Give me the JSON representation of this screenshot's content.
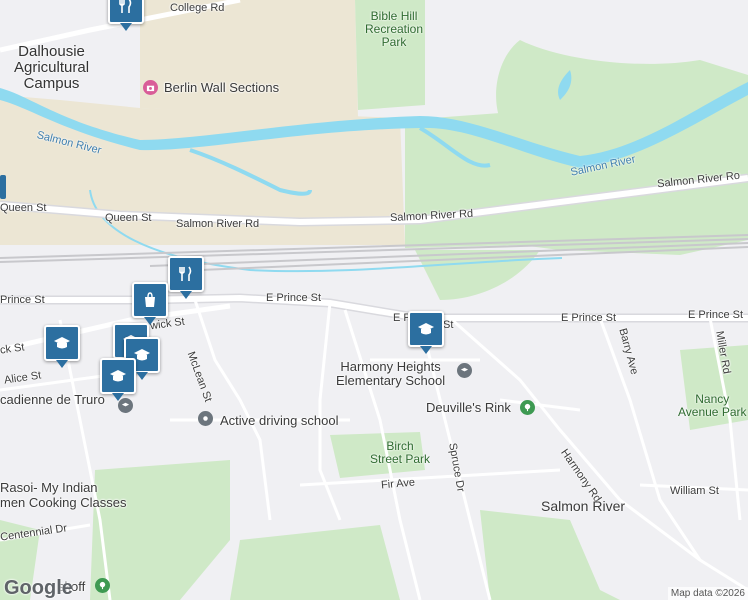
{
  "colors": {
    "water": "#8fdaf0",
    "park": "#cfe9c7",
    "campus": "#ece6d4",
    "road": "#ffffff",
    "pin": "#2c6fa0"
  },
  "labels": {
    "college_rd": "College Rd",
    "dalhousie": "Dalhousie\nAgricultural\nCampus",
    "berlin_wall": "Berlin Wall Sections",
    "bible_hill": "Bible Hill\nRecreation\nPark",
    "salmon_river_west": "Salmon River",
    "salmon_river_east": "Salmon River",
    "salmon_river_rd_east": "Salmon River Ro",
    "queen_st_left": "Queen St",
    "queen_st": "Queen St",
    "salmon_river_rd_1": "Salmon River Rd",
    "salmon_river_rd_2": "Salmon River Rd",
    "prince_st_left": "Prince St",
    "e_prince_st_1": "E Prince St",
    "e_prince_st_2": "E P",
    "e_prince_st_2b": "St",
    "e_prince_st_3": "E Prince St",
    "e_prince_st_4": "E Prince St",
    "wick_st": "wick St",
    "ck_st": "ck St",
    "alice_st": "Alice St",
    "acadienne": "cadienne de Truro",
    "mclean_st": "McLean St",
    "harmony_heights": "Harmony Heights\nElementary School",
    "deuvilles_rink": "Deuville's Rink",
    "active_driving": "Active driving school",
    "birch_street_park": "Birch\nStreet Park",
    "spruce_dr": "Spruce Dr",
    "harmony_rd": "Harmony Rd",
    "barry_ave": "Barry Ave",
    "miller_rd": "Miller Rd",
    "nancy_park": "Nancy\nAvenue Park",
    "william_st": "William St",
    "fir_ave": "Fir Ave",
    "salmon_river_area": "Salmon River",
    "rasoi": "Rasoi- My Indian\nmen Cooking Classes",
    "centennial_dr": "Centennial Dr",
    "skoff": "skoff"
  },
  "icons": {
    "restaurant": "restaurant-icon",
    "shopping": "shopping-bag-icon",
    "school": "school-icon",
    "museum": "museum-icon",
    "park": "park-icon"
  },
  "footer": {
    "google": "Google",
    "attribution": "Map data ©2026"
  }
}
